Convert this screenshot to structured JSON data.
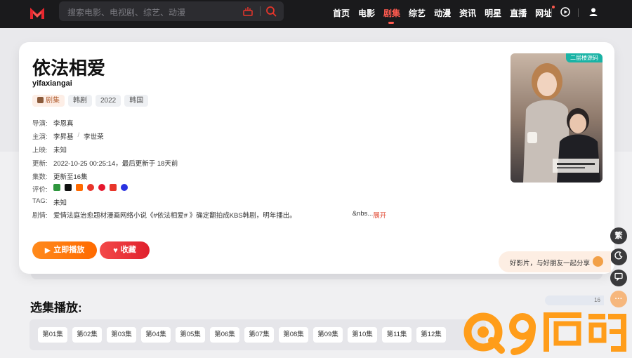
{
  "header": {
    "search_placeholder": "搜索电影、电视剧、综艺、动漫",
    "nav": [
      {
        "label": "首页",
        "active": false
      },
      {
        "label": "电影",
        "active": false
      },
      {
        "label": "剧集",
        "active": true
      },
      {
        "label": "综艺",
        "active": false
      },
      {
        "label": "动漫",
        "active": false
      },
      {
        "label": "资讯",
        "active": false
      },
      {
        "label": "明星",
        "active": false
      },
      {
        "label": "直播",
        "active": false
      },
      {
        "label": "网址",
        "active": false,
        "dot": true
      }
    ],
    "icons": [
      "play-circle-icon",
      "user-icon"
    ]
  },
  "detail": {
    "title": "依法相爱",
    "subtitle": "yifaxiangai",
    "tags": [
      "剧集",
      "韩剧",
      "2022",
      "韩国"
    ],
    "director_label": "导演:",
    "director": "李恩真",
    "cast_label": "主演:",
    "cast": [
      "李昇基",
      "李世荣"
    ],
    "release_label": "上映:",
    "release": "未知",
    "update_label": "更新:",
    "update": "2022-10-25 00:25:14，最后更新于 18天前",
    "episodes_label": "集数:",
    "episodes": "更新至16集",
    "rating_label": "评价:",
    "rating_icons": [
      {
        "name": "douban-icon",
        "color": "#2e963d"
      },
      {
        "name": "douyin-icon",
        "color": "#111111"
      },
      {
        "name": "kuaishou-icon",
        "color": "#ff6a00"
      },
      {
        "name": "xigua-icon",
        "color": "#e8352a"
      },
      {
        "name": "weibo-icon",
        "color": "#e6162d"
      },
      {
        "name": "toutiao-icon",
        "color": "#e8352a"
      },
      {
        "name": "baidu-icon",
        "color": "#2932e1"
      }
    ],
    "tag_label": "TAG:",
    "tag_value": "未知",
    "plot_label": "剧情:",
    "plot": "爱情法庭治愈题材漫画网络小说《#依法相爱# 》确定翻拍成KBS韩剧，明年播出。",
    "plot_tail": "&nbs...",
    "expand_label": "展开",
    "play_label": "立即播放",
    "fav_label": "收藏",
    "poster_badge": "二层楼源码"
  },
  "episodes_section": {
    "title": "选集播放:",
    "items": [
      "第01集",
      "第02集",
      "第03集",
      "第04集",
      "第05集",
      "第06集",
      "第07集",
      "第08集",
      "第09集",
      "第10集",
      "第11集",
      "第12集"
    ]
  },
  "sidebar": {
    "traditional_label": "繁",
    "share_text": "好影片，与好朋友一起分享",
    "count": "16"
  },
  "colors": {
    "accent": "#ff5a4f",
    "play_button": "#ff7a10",
    "fav_button": "#e8262e",
    "header_bg": "#1a1a1c"
  }
}
